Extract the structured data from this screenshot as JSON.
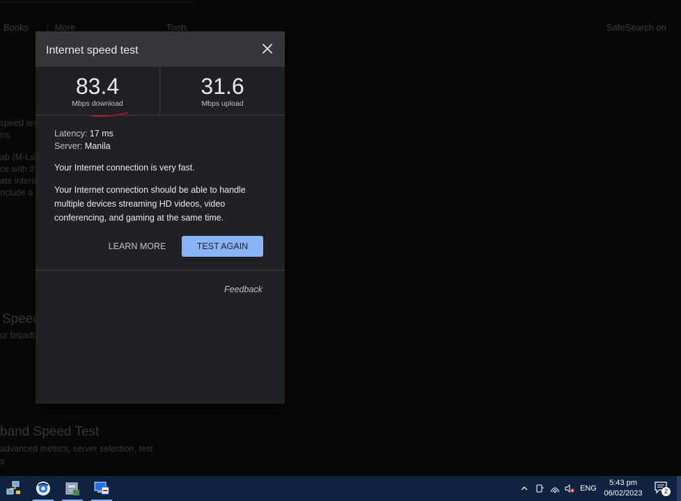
{
  "background": {
    "tabs": [
      "Books",
      "⋮ More",
      "Tools"
    ],
    "safesearch": "SafeSearch on",
    "snippets": [
      "speed test",
      "ns.",
      "ab (M-Lab",
      "ce with th",
      "ate interne",
      "nclude a"
    ],
    "heading1": "Speed",
    "sub1": "ur broadb",
    "heading2": "band Speed Test",
    "sub2": "advanced metrics, server selection, test",
    "sub3": "s"
  },
  "dialog": {
    "title": "Internet speed test",
    "download": {
      "value": "83.4",
      "unit": "Mbps download"
    },
    "upload": {
      "value": "31.6",
      "unit": "Mbps upload"
    },
    "latency_label": "Latency:",
    "latency_value": "17 ms",
    "server_label": "Server:",
    "server_value": "Manila",
    "summary": "Your Internet connection is very fast.",
    "detail_line1": "Your Internet connection should be able to handle",
    "detail_line2": "multiple devices streaming HD videos, video",
    "detail_line3": "conferencing, and gaming at the same time.",
    "learn_more": "LEARN MORE",
    "test_again": "TEST AGAIN",
    "feedback": "Feedback",
    "accent_color": "#8ab4f8",
    "annotation_color": "#c8102e"
  },
  "taskbar": {
    "apps": [
      "network-app-icon",
      "browser-app-icon",
      "folder-app-icon",
      "remote-desktop-app-icon"
    ],
    "language": "ENG",
    "time": "5:43 pm",
    "date": "06/02/2023",
    "notifications": "2"
  }
}
